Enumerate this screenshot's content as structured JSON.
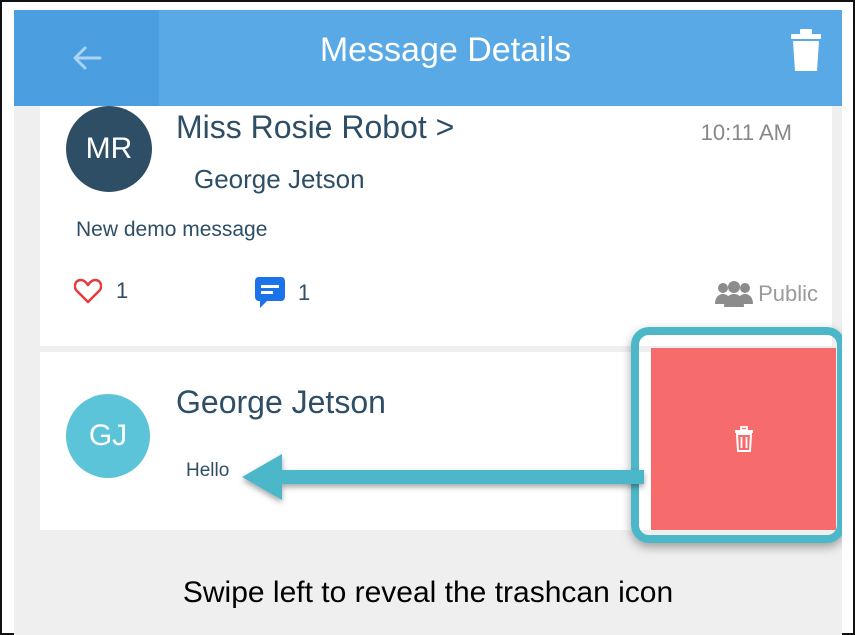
{
  "header": {
    "title": "Message Details",
    "back_icon": "arrow-left-icon",
    "delete_icon": "trash-icon",
    "color": "#58a9e6"
  },
  "messages": [
    {
      "avatar_initials": "MR",
      "avatar_color": "#2e4e66",
      "sender": "Miss Rosie Robot >",
      "recipient": "George Jetson",
      "time": "10:11 AM",
      "body": "New demo message",
      "likes": "1",
      "comments": "1",
      "visibility": "Public"
    },
    {
      "avatar_initials": "GJ",
      "avatar_color": "#5bc4d8",
      "sender": "George Jetson",
      "body": "Hello",
      "swipe_action_icon": "trash-icon",
      "swipe_action_color": "#f66b6b"
    }
  ],
  "annotation": {
    "caption": "Swipe left to reveal the trashcan icon",
    "highlight_color": "#4bb7c8"
  }
}
